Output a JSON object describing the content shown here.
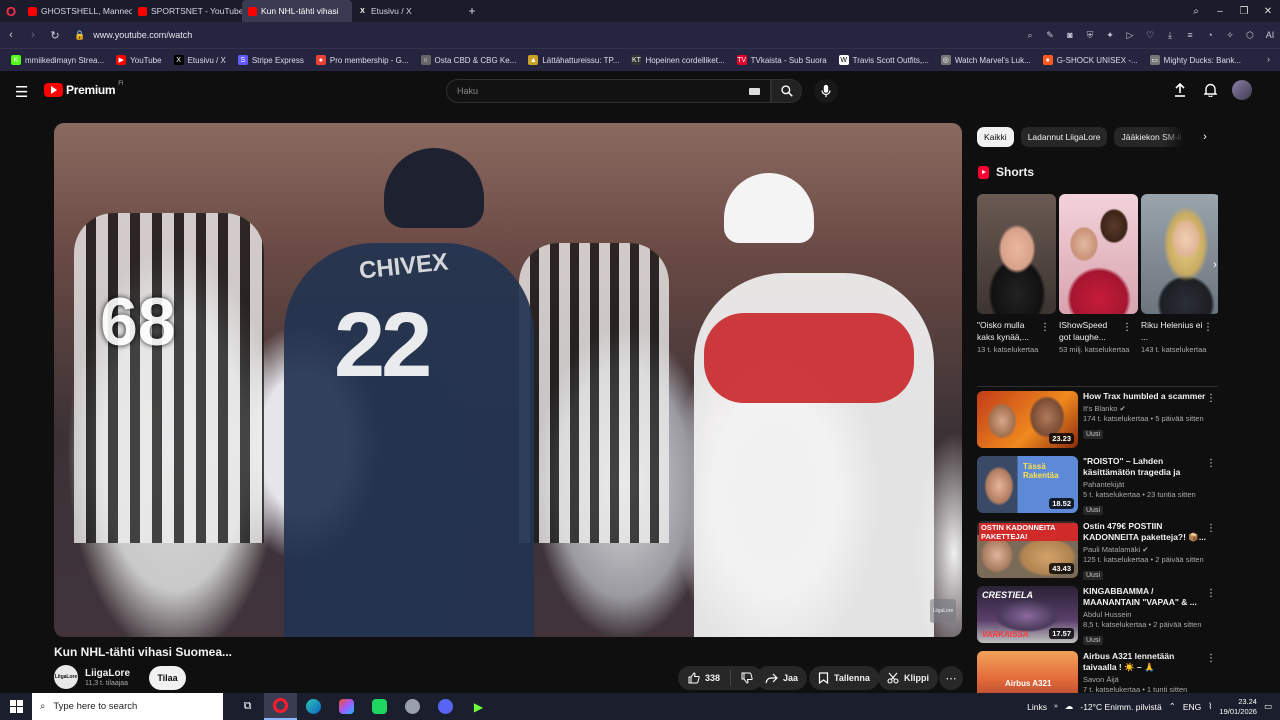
{
  "browser": {
    "tabs": [
      {
        "label": "GHOSTSHELL, Mannequin",
        "icon": "youtube-icon"
      },
      {
        "label": "SPORTSNET - YouTube",
        "icon": "youtube-icon"
      },
      {
        "label": "Kun NHL-tähti vihasi",
        "icon": "youtube-icon",
        "active": true
      },
      {
        "label": "Etusivu / X",
        "icon": "x-icon"
      }
    ],
    "url": "www.youtube.com/watch",
    "bookmarks": [
      {
        "label": "mmiikedimayn Strea...",
        "color": "#53fc18",
        "glyph": "K"
      },
      {
        "label": "YouTube",
        "color": "#ff0000",
        "glyph": "▶"
      },
      {
        "label": "Etusivu / X",
        "color": "#000000",
        "glyph": "X"
      },
      {
        "label": "Stripe Express",
        "color": "#635bff",
        "glyph": "S"
      },
      {
        "label": "Pro membership - G...",
        "color": "#ea4335",
        "glyph": "●"
      },
      {
        "label": "Osta CBD & CBG Ke...",
        "color": "#666666",
        "glyph": "○"
      },
      {
        "label": "Lättähattureissu: TP...",
        "color": "#c9a227",
        "glyph": "▲"
      },
      {
        "label": "Hopeinen cordelliket...",
        "color": "#333333",
        "glyph": "KT"
      },
      {
        "label": "TVkaista - Sub Suora",
        "color": "#e4002b",
        "glyph": "TV"
      },
      {
        "label": "Travis Scott Outfits,...",
        "color": "#ffffff",
        "glyph": "W"
      },
      {
        "label": "Watch Marvel's Luk...",
        "color": "#777777",
        "glyph": "◎"
      },
      {
        "label": "G-SHOCK UNISEX -...",
        "color": "#ff5a1f",
        "glyph": "●"
      },
      {
        "label": "Mighty Ducks: Bank...",
        "color": "#777777",
        "glyph": "▭"
      }
    ]
  },
  "header": {
    "logo_text": "Premium",
    "logo_region": "FI",
    "search_placeholder": "Haku"
  },
  "video": {
    "title": "Kun NHL-tähti vihasi Suomea...",
    "channel": "LiigaLore",
    "channel_avatar_text": "LiigaLore",
    "subscribers": "11,3 t. tilaajaa",
    "subscribe_label": "Tilaa",
    "likes": "338",
    "share_label": "Jaa",
    "save_label": "Tallenna",
    "clip_label": "Klippi",
    "watermark": "LiigaLore",
    "overlay_numbers": [
      "68",
      "22"
    ],
    "overlay_name": "CHIVEX"
  },
  "sidebar": {
    "chips": [
      {
        "label": "Kaikki",
        "selected": true
      },
      {
        "label": "Ladannut LiigaLore",
        "selected": false
      },
      {
        "label": "Jääkiekon SM-li",
        "selected": false
      }
    ],
    "shorts_title": "Shorts",
    "shorts": [
      {
        "title": "\"Oisko mulla kaks kynää,...",
        "views": "13 t. katselukertaa"
      },
      {
        "title": "IShowSpeed got laughe...",
        "views": "53 milj. katselukertaa"
      },
      {
        "title": "Riku Helenius ei ...",
        "views": "143 t. katselukertaa"
      }
    ],
    "recommendations": [
      {
        "title": "How Trax humbled a scammer",
        "channel": "It's Blanko",
        "verified": true,
        "meta": "174 t. katselukertaa • 5 päivää sitten",
        "badge": "Uusi",
        "duration": "23.23"
      },
      {
        "title": "\"ROISTO\" – Lahden käsittämätön tragedia ja klovn...",
        "channel": "Pahantekijät",
        "verified": false,
        "meta": "5 t. katselukertaa • 23 tuntia sitten",
        "badge": "Uusi",
        "duration": "18.52"
      },
      {
        "title": "Ostin 479€ POSTIIN KADONNEITA paketteja?! 📦...",
        "channel": "Pauli Matalamäki",
        "verified": true,
        "meta": "125 t. katselukertaa • 2 päivää sitten",
        "badge": "Uusi",
        "duration": "43.43"
      },
      {
        "title": "KINGABBAMMA / MAANANTAIN \"VAPAA\" & ...",
        "channel": "Abdul Hussein",
        "verified": false,
        "meta": "8,5 t. katselukertaa • 2 päivää sitten",
        "badge": "Uusi",
        "duration": "17.57"
      },
      {
        "title": "Airbus A321 lennetään taivaalla ! ☀️ – 🙏",
        "channel": "Savon Äijä",
        "verified": false,
        "meta": "7 t. katselukertaa • 1 tunti sitten",
        "badge": "",
        "duration": ""
      }
    ]
  },
  "taskbar": {
    "search_placeholder": "Type here to search",
    "links_label": "Links",
    "weather": "-12°C  Enimm. pilvistä",
    "language": "ENG",
    "time": "23.24",
    "date": "19/01/2026"
  }
}
